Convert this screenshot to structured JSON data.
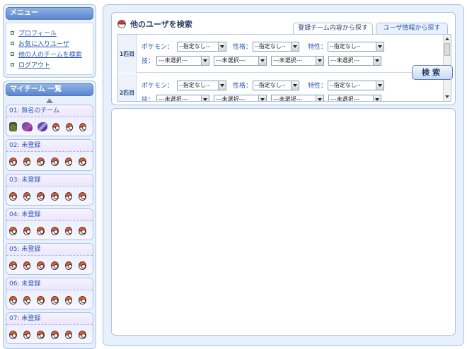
{
  "menu": {
    "title": "メニュー",
    "items": [
      {
        "label": "プロフィール"
      },
      {
        "label": "お気に入りユーザ"
      },
      {
        "label": "他の人のチームを検索"
      },
      {
        "label": "ログアウト"
      }
    ]
  },
  "my_team": {
    "title": "マイチーム 一覧",
    "teams": [
      {
        "name": "01: 無名のチーム",
        "slots": [
          "pokemon-icon-1",
          "pokemon-icon-2",
          "pokemon-icon-3",
          "pokeball-icon",
          "pokeball-icon",
          "pokeball-icon"
        ]
      },
      {
        "name": "02: 未登録"
      },
      {
        "name": "03: 未登録"
      },
      {
        "name": "04: 未登録"
      },
      {
        "name": "05: 未登録"
      },
      {
        "name": "06: 未登録"
      },
      {
        "name": "07: 未登録"
      }
    ]
  },
  "search": {
    "title": "他のユーザを検索",
    "tabs": [
      {
        "label": "登録チーム内容から探す",
        "active": true
      },
      {
        "label": "ユーザ情報から探す",
        "active": false
      }
    ],
    "rows": [
      {
        "label": "1匹目",
        "pokemon_label": "ポケモン：",
        "pokemon_value": "--指定なし--",
        "nature_label": "性格：",
        "nature_value": "--指定なし--",
        "ability_label": "特性：",
        "ability_value": "--指定なし--",
        "move_label": "技：",
        "moves": [
          "---未選択---",
          "---未選択---",
          "---未選択---",
          "---未選択---"
        ]
      },
      {
        "label": "2匹目",
        "pokemon_label": "ポケモン：",
        "pokemon_value": "--指定なし--",
        "nature_label": "性格：",
        "nature_value": "--指定なし--",
        "ability_label": "特性：",
        "ability_value": "--指定なし--",
        "move_label": "技：",
        "moves": [
          "---未選択---",
          "---未選択---",
          "---未選択---",
          "---未選択---"
        ]
      }
    ],
    "button_label": "検索"
  },
  "colors": {
    "accent": "#5a86cf",
    "border": "#a9c2e6",
    "panel_bg": "#e8f0fb",
    "link": "#2a58b8"
  }
}
